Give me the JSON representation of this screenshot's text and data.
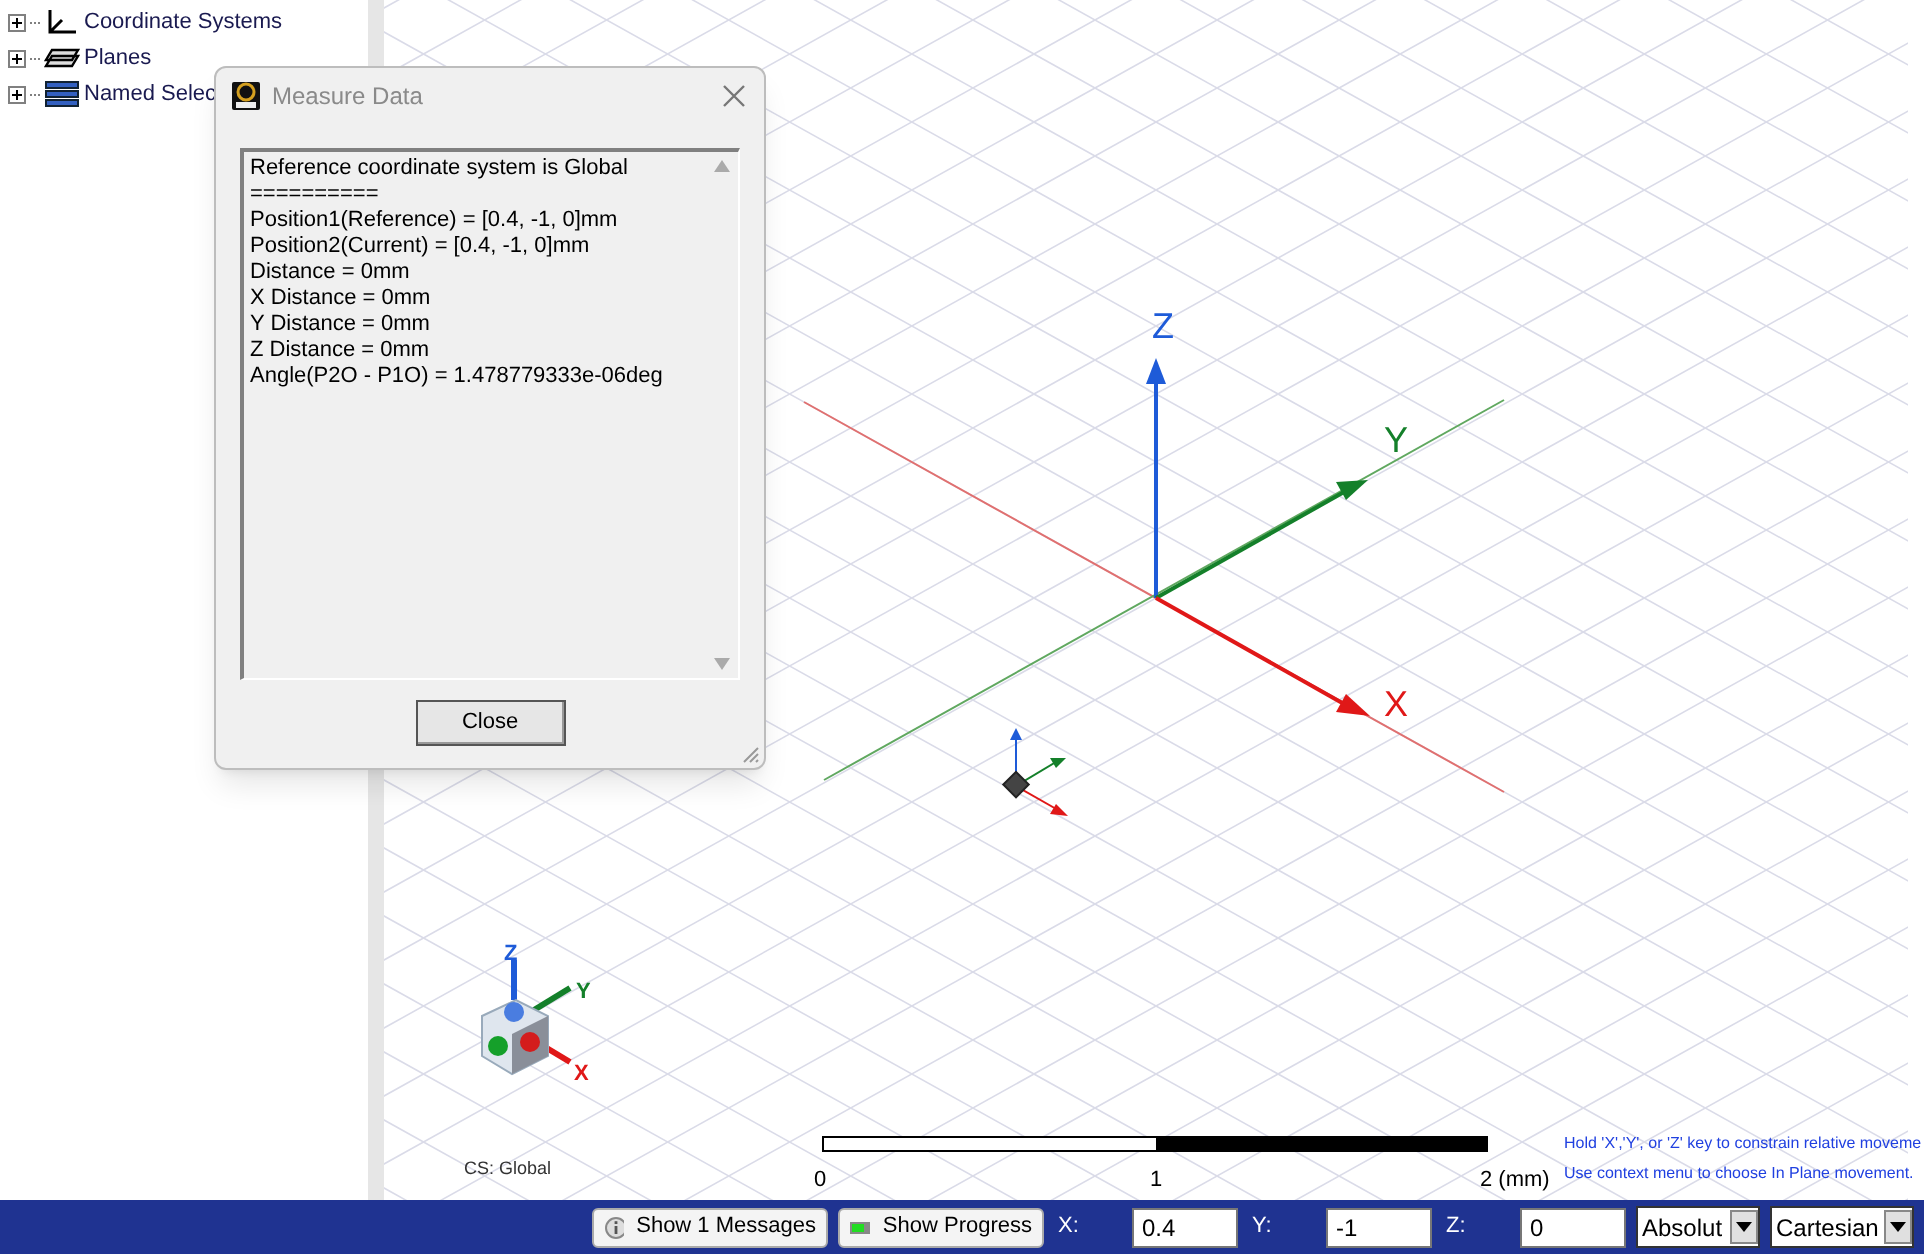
{
  "tree": [
    {
      "label": "Coordinate Systems",
      "expanded": false,
      "kind": "axes"
    },
    {
      "label": "Planes",
      "expanded": false,
      "kind": "planes"
    },
    {
      "label": "Named Selec",
      "expanded": false,
      "kind": "list"
    }
  ],
  "dialog": {
    "title": "Measure Data",
    "lines": [
      "Reference coordinate system is Global",
      "==========",
      "Position1(Reference) = [0.4, -1, 0]mm",
      "Position2(Current) = [0.4, -1, 0]mm",
      "Distance = 0mm",
      "X Distance = 0mm",
      "Y Distance = 0mm",
      "Z Distance = 0mm",
      "Angle(P2O - P1O) = 1.478779333e-06deg"
    ],
    "close_button": "Close"
  },
  "viewport": {
    "axes": {
      "z": "Z",
      "y": "Y",
      "x": "X"
    },
    "triad": {
      "z": "Z",
      "y": "Y",
      "x": "X"
    },
    "cs_label": "CS: Global",
    "scale": [
      "0",
      "1",
      "2 (mm)"
    ],
    "hints": [
      "Hold 'X','Y', or 'Z' key to constrain relative moveme",
      "Use context menu to choose In Plane movement."
    ]
  },
  "status_bar": {
    "messages_button": "Show 1 Messages",
    "progress_button": "Show Progress",
    "coords": [
      {
        "label": "X:",
        "value": "0.4"
      },
      {
        "label": "Y:",
        "value": "-1"
      },
      {
        "label": "Z:",
        "value": "0"
      }
    ],
    "selects": [
      "Absolut",
      "Cartesian"
    ]
  }
}
